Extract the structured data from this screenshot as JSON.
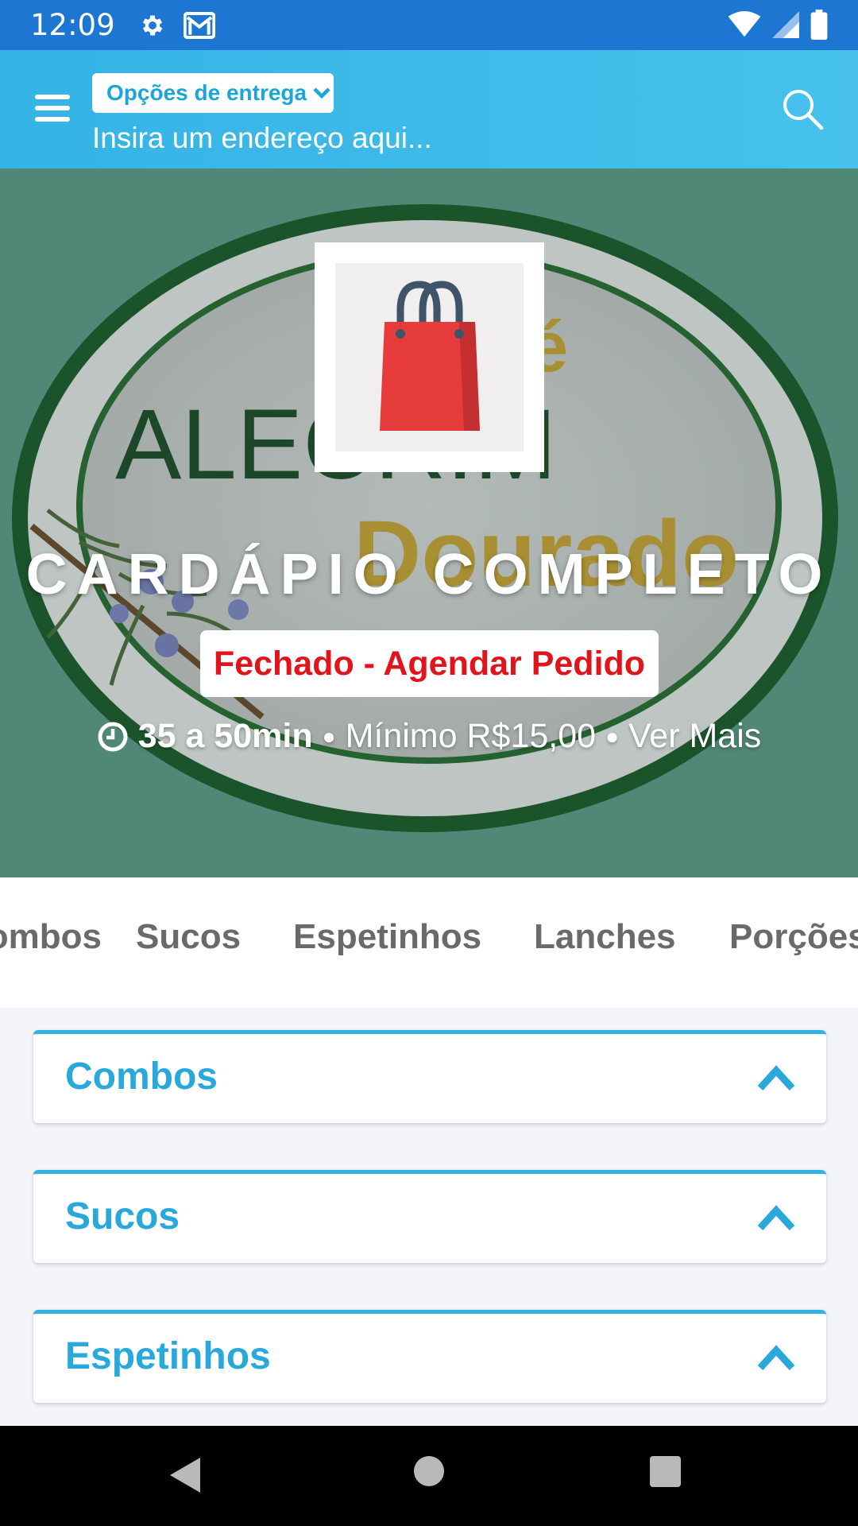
{
  "status_bar": {
    "time": "12:09",
    "icons_left": [
      "settings-icon",
      "gmail-icon"
    ],
    "icons_right": [
      "wifi-icon",
      "signal-icon",
      "battery-icon"
    ]
  },
  "header": {
    "delivery_options_label": "Opções de entrega",
    "address_placeholder": "Insira um endereço aqui...",
    "icons": [
      "menu-icon",
      "chevron-down-icon",
      "search-icon"
    ]
  },
  "hero": {
    "title": "CARDÁPIO COMPLETO",
    "status_button": "Fechado - Agendar Pedido",
    "delivery_time": "35 a 50min",
    "separator": "●",
    "minimum_order": "Mínimo R$15,00",
    "see_more": "Ver Mais",
    "background_art": {
      "word1": "ALECRIM",
      "word2": "Dourado",
      "word3": "é"
    }
  },
  "category_tabs": [
    "Combos",
    "Sucos",
    "Espetinhos",
    "Lanches",
    "Porções"
  ],
  "sections": [
    {
      "title": "Combos"
    },
    {
      "title": "Sucos"
    },
    {
      "title": "Espetinhos"
    }
  ],
  "colors": {
    "status_bar": "#1d76d2",
    "header": "#3dbbea",
    "accent": "#29a8dc",
    "closed_red": "#e2141b"
  }
}
